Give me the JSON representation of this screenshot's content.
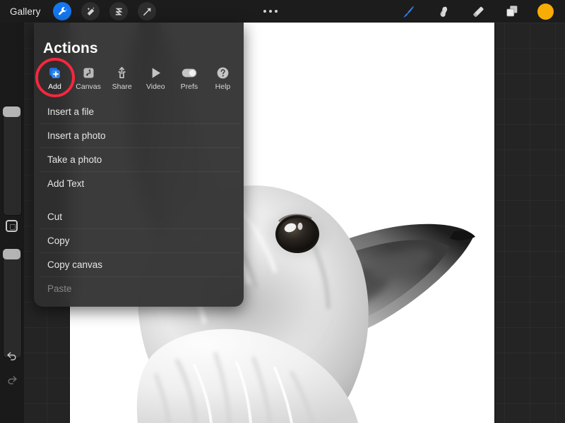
{
  "topbar": {
    "gallery_label": "Gallery",
    "left_tools": [
      {
        "name": "actions-wrench-icon",
        "label": "Actions",
        "active": true
      },
      {
        "name": "adjustments-wand-icon",
        "label": "Adjustments",
        "active": false
      },
      {
        "name": "selection-s-icon",
        "label": "Selection",
        "active": false
      },
      {
        "name": "transform-arrow-icon",
        "label": "Transform",
        "active": false
      }
    ],
    "overflow_menu": "more-options-icon",
    "right_tools": [
      {
        "name": "paint-brush-icon",
        "label": "Paint",
        "active": true
      },
      {
        "name": "smudge-icon",
        "label": "Smudge",
        "active": false
      },
      {
        "name": "eraser-icon",
        "label": "Erase",
        "active": false
      },
      {
        "name": "layers-icon",
        "label": "Layers",
        "active": false
      }
    ],
    "color_swatch": "#f7ad05"
  },
  "sidebar": {
    "brush_size_label": "Brush size",
    "opacity_label": "Opacity",
    "modify_label": "Modify",
    "undo_label": "Undo",
    "redo_label": "Redo"
  },
  "actions_panel": {
    "title": "Actions",
    "tabs": [
      {
        "label": "Add",
        "icon": "add-layers-icon",
        "selected": true,
        "highlighted": true
      },
      {
        "label": "Canvas",
        "icon": "canvas-crop-icon",
        "selected": false,
        "highlighted": false
      },
      {
        "label": "Share",
        "icon": "share-upload-icon",
        "selected": false,
        "highlighted": false
      },
      {
        "label": "Video",
        "icon": "video-play-icon",
        "selected": false,
        "highlighted": false
      },
      {
        "label": "Prefs",
        "icon": "prefs-toggle-icon",
        "selected": false,
        "highlighted": false
      },
      {
        "label": "Help",
        "icon": "help-question-icon",
        "selected": false,
        "highlighted": false
      }
    ],
    "menu_group_1": [
      {
        "label": "Insert a file",
        "disabled": false
      },
      {
        "label": "Insert a photo",
        "disabled": false
      },
      {
        "label": "Take a photo",
        "disabled": false
      },
      {
        "label": "Add Text",
        "disabled": false
      }
    ],
    "menu_group_2": [
      {
        "label": "Cut",
        "disabled": false
      },
      {
        "label": "Copy",
        "disabled": false
      },
      {
        "label": "Copy canvas",
        "disabled": false
      },
      {
        "label": "Paste",
        "disabled": true
      }
    ],
    "highlight_color": "#f4273f"
  },
  "canvas": {
    "artwork_title": "Fennec fox grayscale drawing",
    "background": "#ffffff"
  }
}
